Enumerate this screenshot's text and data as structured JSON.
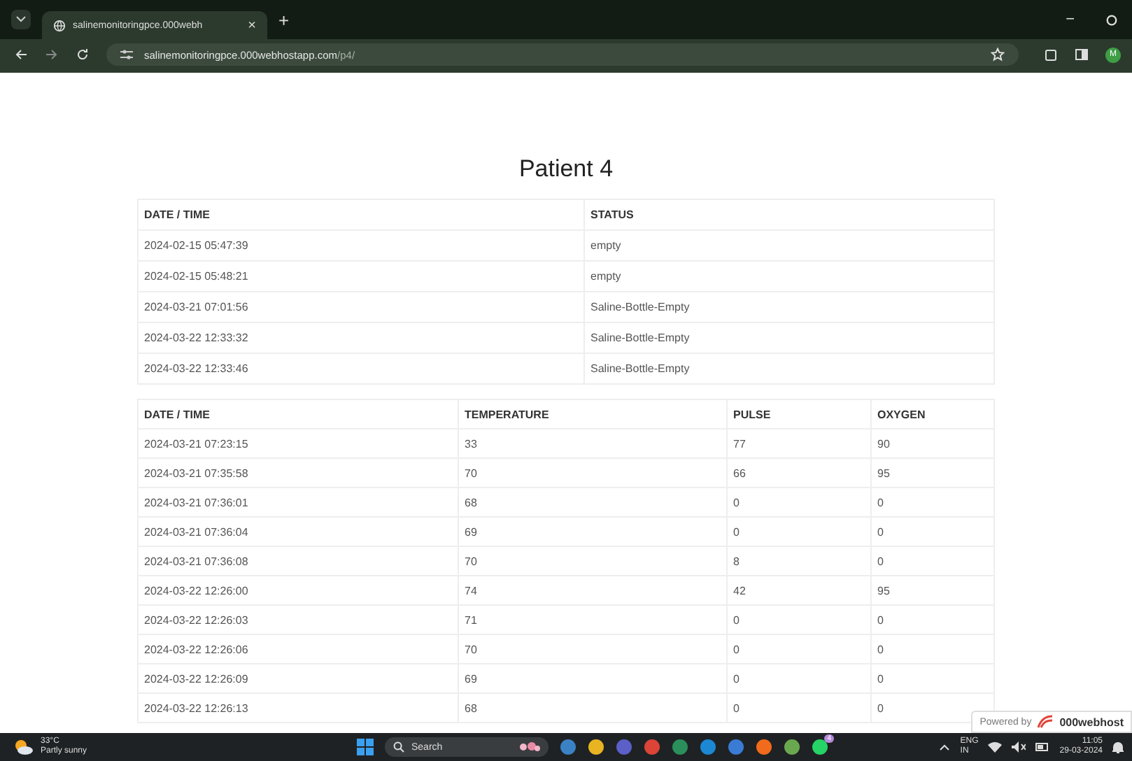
{
  "browser": {
    "tab_title": "salinemonitoringpce.000webh",
    "url_host": "salinemonitoringpce.000webhostapp.com",
    "url_path": "/p4/",
    "new_tab": "+",
    "close_tab": "×",
    "minimize": "−",
    "profile": "M"
  },
  "page": {
    "title": "Patient 4"
  },
  "status_table": {
    "columns": [
      "DATE / TIME",
      "STATUS"
    ],
    "rows": [
      [
        "2024-02-15 05:47:39",
        "empty"
      ],
      [
        "2024-02-15 05:48:21",
        "empty"
      ],
      [
        "2024-03-21 07:01:56",
        "Saline-Bottle-Empty"
      ],
      [
        "2024-03-22 12:33:32",
        "Saline-Bottle-Empty"
      ],
      [
        "2024-03-22 12:33:46",
        "Saline-Bottle-Empty"
      ]
    ]
  },
  "vitals_table": {
    "columns": [
      "DATE / TIME",
      "TEMPERATURE",
      "PULSE",
      "OXYGEN"
    ],
    "rows": [
      [
        "2024-03-21 07:23:15",
        "33",
        "77",
        "90"
      ],
      [
        "2024-03-21 07:35:58",
        "70",
        "66",
        "95"
      ],
      [
        "2024-03-21 07:36:01",
        "68",
        "0",
        "0"
      ],
      [
        "2024-03-21 07:36:04",
        "69",
        "0",
        "0"
      ],
      [
        "2024-03-21 07:36:08",
        "70",
        "8",
        "0"
      ],
      [
        "2024-03-22 12:26:00",
        "74",
        "42",
        "95"
      ],
      [
        "2024-03-22 12:26:03",
        "71",
        "0",
        "0"
      ],
      [
        "2024-03-22 12:26:06",
        "70",
        "0",
        "0"
      ],
      [
        "2024-03-22 12:26:09",
        "69",
        "0",
        "0"
      ],
      [
        "2024-03-22 12:26:13",
        "68",
        "0",
        "0"
      ]
    ]
  },
  "badge": {
    "prefix": "Powered by",
    "brand": "000webhost"
  },
  "taskbar": {
    "temperature": "33°C",
    "weather": "Partly sunny",
    "search": "Search",
    "language": "ENG",
    "region": "IN",
    "time": "11:05",
    "date": "29-03-2024",
    "notification_count": "4"
  }
}
